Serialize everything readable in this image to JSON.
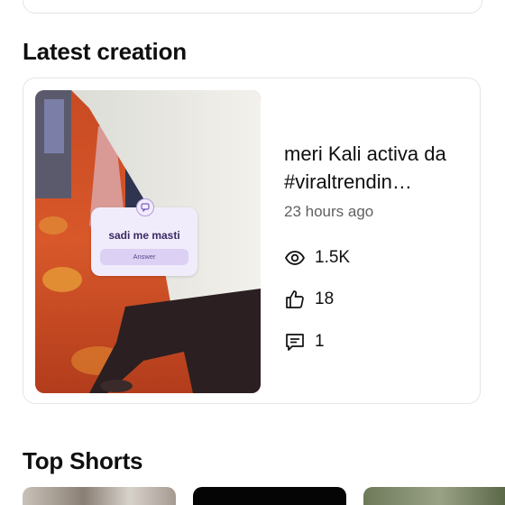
{
  "sections": {
    "latest_title": "Latest creation",
    "shorts_title": "Top Shorts"
  },
  "latest_video": {
    "title": "meri Kali activa da #viraltrendin…",
    "age": "23 hours ago",
    "sticker_question": "sadi me masti",
    "sticker_answer": "Answer",
    "stats": {
      "views": "1.5K",
      "likes": "18",
      "comments": "1"
    }
  },
  "icons": {
    "views": "eye-icon",
    "likes": "thumbs-up-icon",
    "comments": "comment-icon"
  }
}
